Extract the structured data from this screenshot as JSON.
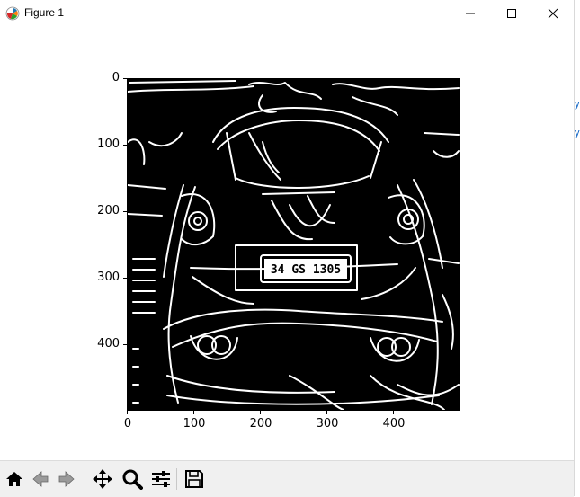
{
  "window": {
    "title": "Figure 1",
    "icon": "matplotlib-icon"
  },
  "controls": {
    "minimize_icon": "minimize-icon",
    "maximize_icon": "maximize-icon",
    "close_icon": "close-icon"
  },
  "axes": {
    "y_ticks": [
      "0",
      "100",
      "200",
      "300",
      "400"
    ],
    "x_ticks": [
      "0",
      "100",
      "200",
      "300",
      "400"
    ]
  },
  "image": {
    "description_type": "edge-detection",
    "plate_text": "34 GS 1305",
    "background": "#000000",
    "edges": "#ffffff"
  },
  "toolbar": {
    "buttons": [
      {
        "icon": "home-icon"
      },
      {
        "icon": "back-icon"
      },
      {
        "icon": "forward-icon"
      },
      {
        "icon": "pan-icon"
      },
      {
        "icon": "zoom-icon"
      },
      {
        "icon": "configure-subplots-icon"
      },
      {
        "icon": "save-icon"
      }
    ]
  },
  "side": {
    "chars": [
      "y",
      "y"
    ]
  }
}
